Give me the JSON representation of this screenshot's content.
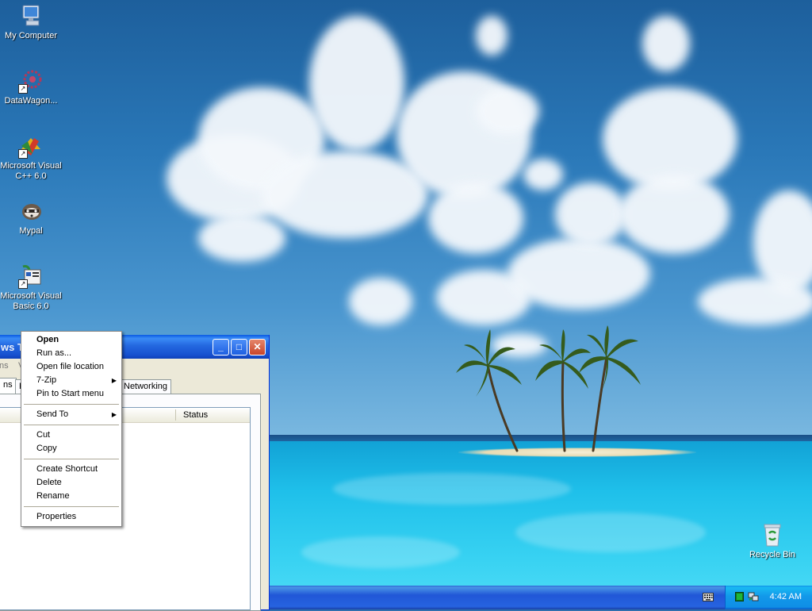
{
  "desktop": {
    "icons": [
      {
        "label": "My Computer",
        "icon": "my-computer-icon"
      },
      {
        "label": "DataWagon...",
        "icon": "datawagon-icon"
      },
      {
        "label": "Microsoft Visual C++ 6.0",
        "icon": "visual-cpp-icon"
      },
      {
        "label": "Mypal",
        "icon": "mypal-icon"
      },
      {
        "label": "Microsoft Visual Basic 6.0",
        "icon": "visual-basic-icon"
      },
      {
        "label": "Recycle Bin",
        "icon": "recycle-bin-icon"
      }
    ]
  },
  "window": {
    "title_fragment": "ws T",
    "menu_fragments": [
      "ns",
      "V"
    ],
    "tabs": [
      "ns",
      "P",
      "Networking"
    ],
    "columns": {
      "status": "Status"
    }
  },
  "context_menu": {
    "items": [
      {
        "label": "Open",
        "bold": true
      },
      {
        "label": "Run as..."
      },
      {
        "label": "Open file location"
      },
      {
        "label": "7-Zip",
        "submenu": true
      },
      {
        "label": "Pin to Start menu"
      },
      {
        "label": "Send To",
        "submenu": true
      },
      {
        "label": "Cut"
      },
      {
        "label": "Copy"
      },
      {
        "label": "Create Shortcut"
      },
      {
        "label": "Delete"
      },
      {
        "label": "Rename"
      },
      {
        "label": "Properties"
      }
    ],
    "submenu_arrow": "▶"
  },
  "taskbar": {
    "clock": "4:42 AM"
  },
  "colors": {
    "taskbar": "#2157d7",
    "tray": "#1298e9",
    "titlebar": "#2468e0"
  }
}
